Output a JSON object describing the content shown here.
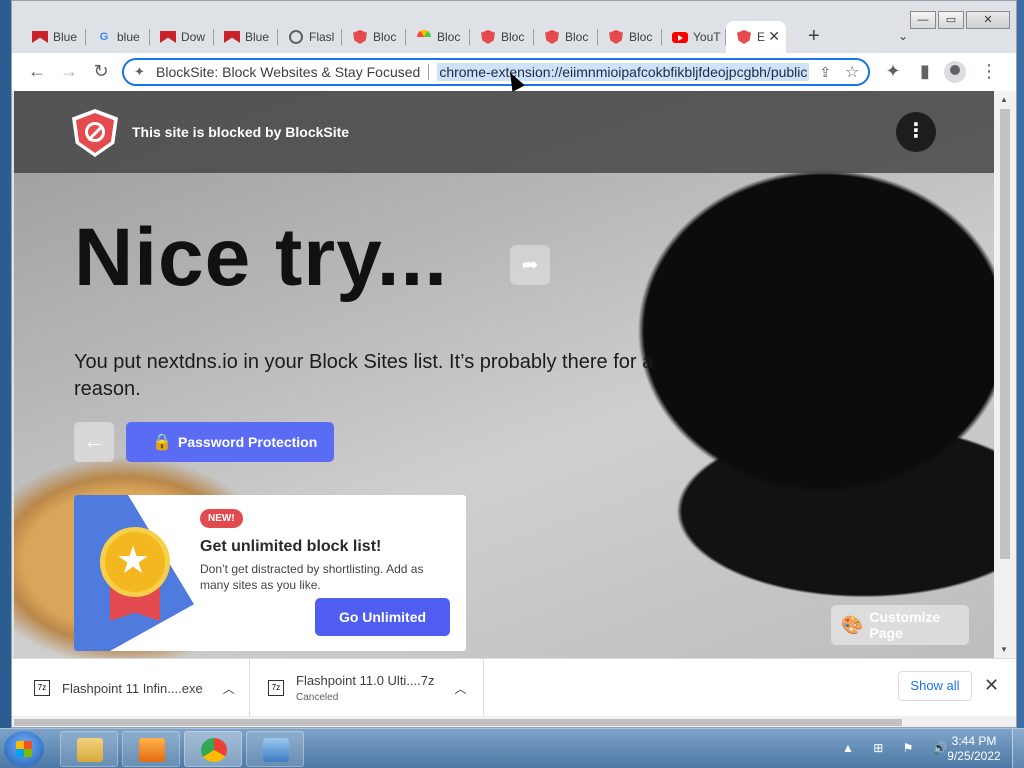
{
  "window": {
    "controls": {
      "minimize": "—",
      "maximize": "▭",
      "close": "✕"
    }
  },
  "tabs": [
    {
      "title": "Blue",
      "icon": "bluemaxima-icon"
    },
    {
      "title": "blue",
      "icon": "google-icon"
    },
    {
      "title": "Dow",
      "icon": "bluemaxima-icon"
    },
    {
      "title": "Blue",
      "icon": "bluemaxima-icon"
    },
    {
      "title": "Flasl",
      "icon": "globe-icon"
    },
    {
      "title": "Bloc",
      "icon": "blocksite-icon"
    },
    {
      "title": "Bloc",
      "icon": "rainbow-icon"
    },
    {
      "title": "Bloc",
      "icon": "blocksite-icon"
    },
    {
      "title": "Bloc",
      "icon": "blocksite-icon"
    },
    {
      "title": "Bloc",
      "icon": "blocksite-icon"
    },
    {
      "title": "YouT",
      "icon": "youtube-icon"
    },
    {
      "title": "E",
      "icon": "blocksite-icon",
      "active": true
    }
  ],
  "tabstrip": {
    "new_tab": "+",
    "tab_search": "⌄",
    "tab_close": "✕"
  },
  "toolbar": {
    "back": "←",
    "forward": "→",
    "reload": "↻",
    "site_name": "BlockSite: Block Websites & Stay Focused",
    "url": "chrome-extension://eiimnmioipafcokbfikbljfdeojpcgbh/public",
    "extensions": "✦",
    "side_panel": "▮",
    "menu": "⋮"
  },
  "page": {
    "header_title": "This site is blocked by BlockSite",
    "kebab": "⋮",
    "headline": "Nice try...",
    "share": "➦",
    "subtext": "You put nextdns.io in your Block Sites list. It’s probably there for a reason.",
    "back": "←",
    "password_button": "Password Protection",
    "promo": {
      "badge": "NEW!",
      "title": "Get unlimited block list!",
      "description": "Don’t get distracted by shortlisting. Add as many sites as you like.",
      "button": "Go Unlimited"
    },
    "customize": "Customize Page"
  },
  "downloads": [
    {
      "name": "Flashpoint 11 Infin....exe",
      "status": ""
    },
    {
      "name": "Flashpoint 11.0 Ulti....7z",
      "status": "Canceled"
    }
  ],
  "downloads_bar": {
    "show_all": "Show all",
    "close": "✕"
  },
  "taskbar": {
    "time": "3:44 PM",
    "date": "9/25/2022",
    "tray": "▲ ⊞ ⚑ 🔊"
  }
}
